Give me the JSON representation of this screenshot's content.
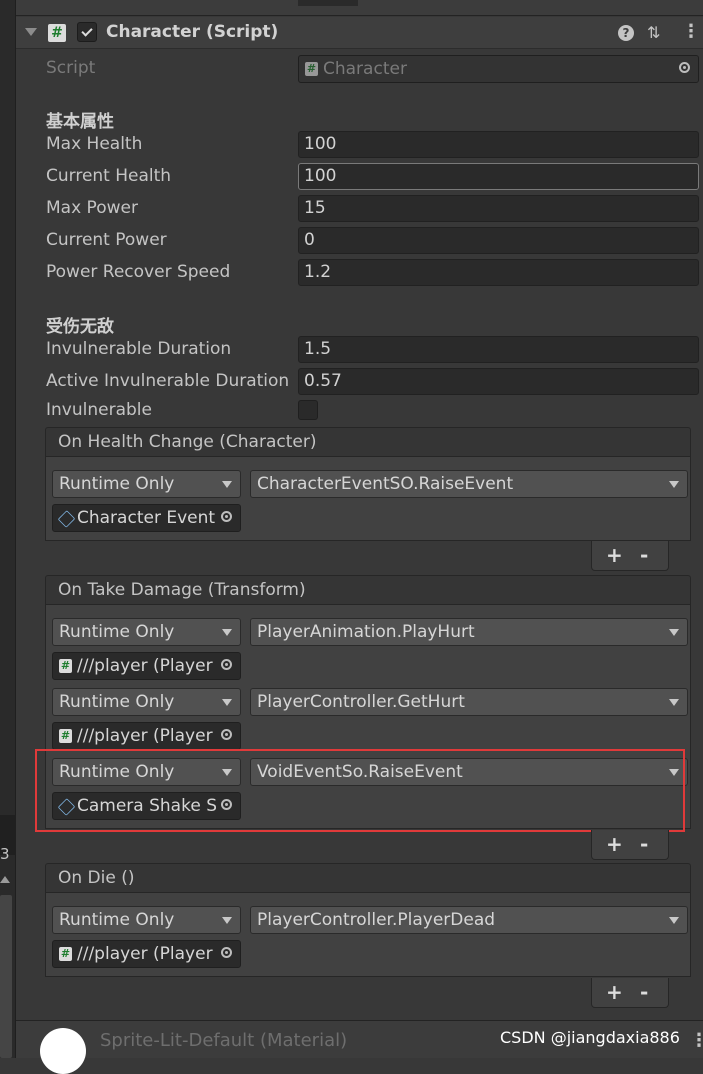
{
  "component": {
    "title": "Character (Script)",
    "script_label": "Script",
    "script_value": "Character"
  },
  "sections": {
    "basic": "基本属性",
    "invuln": "受伤无敌"
  },
  "fields": {
    "max_health": {
      "label": "Max Health",
      "value": "100"
    },
    "current_health": {
      "label": "Current Health",
      "value": "100"
    },
    "max_power": {
      "label": "Max Power",
      "value": "15"
    },
    "current_power": {
      "label": "Current Power",
      "value": "0"
    },
    "power_recover": {
      "label": "Power Recover Speed",
      "value": "1.2"
    },
    "invuln_duration": {
      "label": "Invulnerable Duration",
      "value": "1.5"
    },
    "active_invuln_duration": {
      "label": "Active Invulnerable Duration",
      "value": "0.57"
    },
    "invulnerable": {
      "label": "Invulnerable",
      "checked": false
    }
  },
  "events": {
    "health_change": {
      "title": "On Health Change (Character)",
      "listeners": [
        {
          "mode": "Runtime Only",
          "function": "CharacterEventSO.RaiseEvent",
          "target": "Character Event",
          "target_icon": "scriptable-object-icon"
        }
      ]
    },
    "take_damage": {
      "title": "On Take Damage (Transform)",
      "listeners": [
        {
          "mode": "Runtime Only",
          "function": "PlayerAnimation.PlayHurt",
          "target": "///player (Player",
          "target_icon": "script-icon"
        },
        {
          "mode": "Runtime Only",
          "function": "PlayerController.GetHurt",
          "target": "///player (Player",
          "target_icon": "script-icon"
        },
        {
          "mode": "Runtime Only",
          "function": "VoidEventSo.RaiseEvent",
          "target": "Camera Shake S",
          "target_icon": "scriptable-object-icon"
        }
      ]
    },
    "die": {
      "title": "On Die ()",
      "listeners": [
        {
          "mode": "Runtime Only",
          "function": "PlayerController.PlayerDead",
          "target": "///player (Player",
          "target_icon": "script-icon"
        }
      ]
    },
    "plus": "+",
    "minus": "-"
  },
  "footer": {
    "material": "Sprite-Lit-Default (Material)",
    "watermark": "CSDN @jiangdaxia886"
  },
  "left_gutter": {
    "number": "3"
  },
  "colors": {
    "highlight_box": "#e03a3a",
    "background": "#383838"
  }
}
